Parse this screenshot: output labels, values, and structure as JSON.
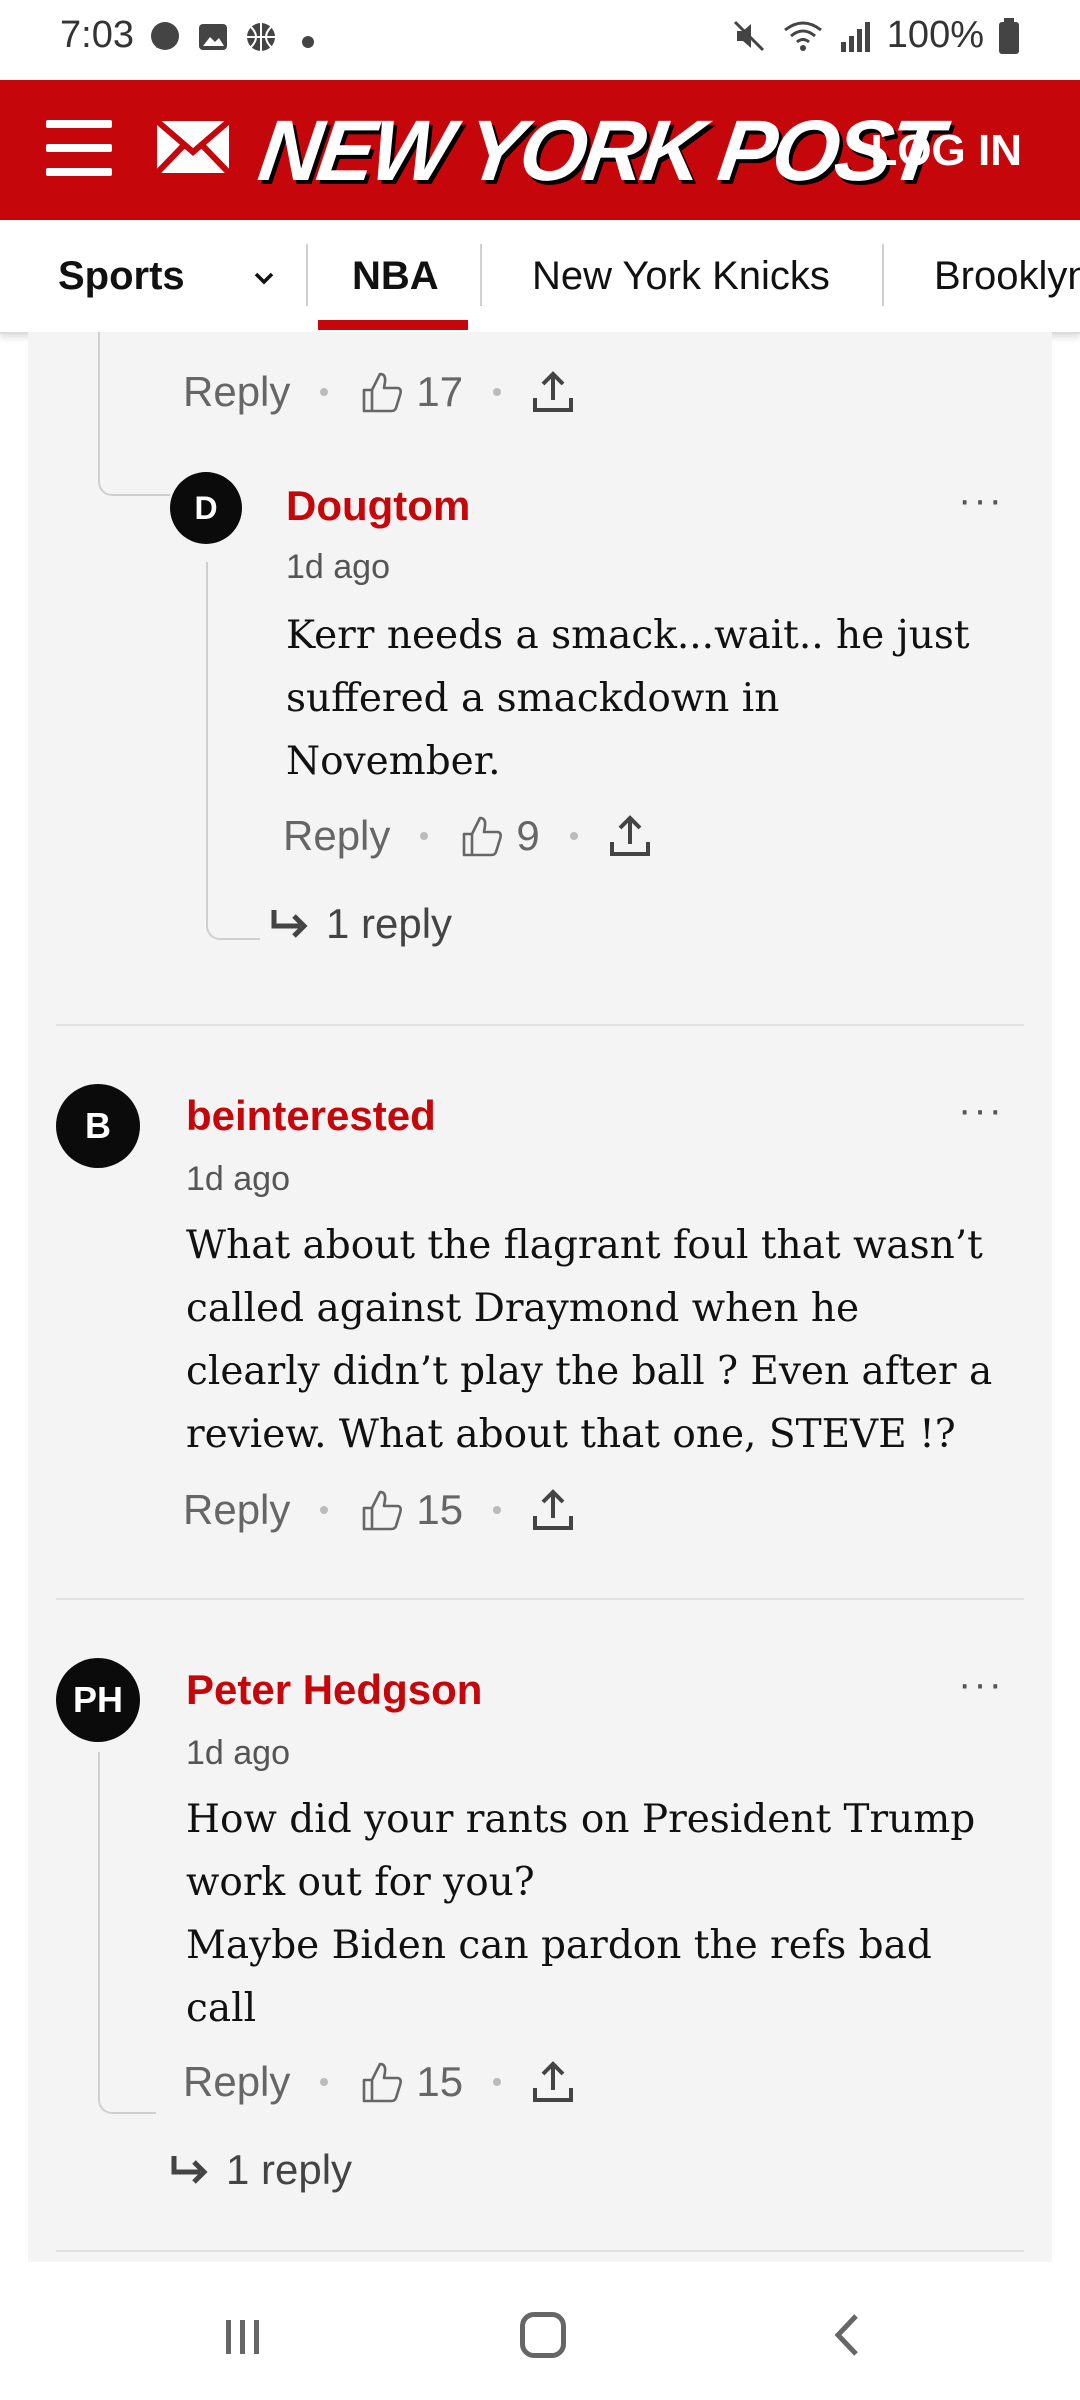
{
  "status_bar": {
    "time": "7:03",
    "battery": "100%"
  },
  "header": {
    "logo": "NEW YORK POST",
    "login": "LOG IN"
  },
  "nav": {
    "sports": "Sports",
    "nba": "NBA",
    "knicks": "New York Knicks",
    "brooklyn": "Brooklyn"
  },
  "comments": [
    {
      "likes": "17",
      "reply_label": "Reply"
    },
    {
      "avatar": "D",
      "user": "Dougtom",
      "time": "1d ago",
      "lines": [
        "Kerr needs a smack...wait.. he just",
        "suffered a smackdown in",
        "November."
      ],
      "reply_label": "Reply",
      "likes": "9",
      "replies": "1 reply"
    },
    {
      "avatar": "B",
      "user": "beinterested",
      "time": "1d ago",
      "lines": [
        "What about the flagrant foul that wasn’t",
        "called against Draymond when he",
        "clearly didn’t play the ball ? Even after a",
        "review.  What about that one, STEVE !?"
      ],
      "reply_label": "Reply",
      "likes": "15"
    },
    {
      "avatar": "PH",
      "user": "Peter Hedgson",
      "time": "1d ago",
      "lines": [
        "How did your rants on President Trump",
        "work out for you?",
        "Maybe Biden can pardon the refs bad",
        "call"
      ],
      "reply_label": "Reply",
      "likes": "15",
      "replies": "1 reply"
    }
  ],
  "more_label": "···",
  "colors": {
    "brand_red": "#c5070b",
    "panel": "#f4f4f4"
  }
}
